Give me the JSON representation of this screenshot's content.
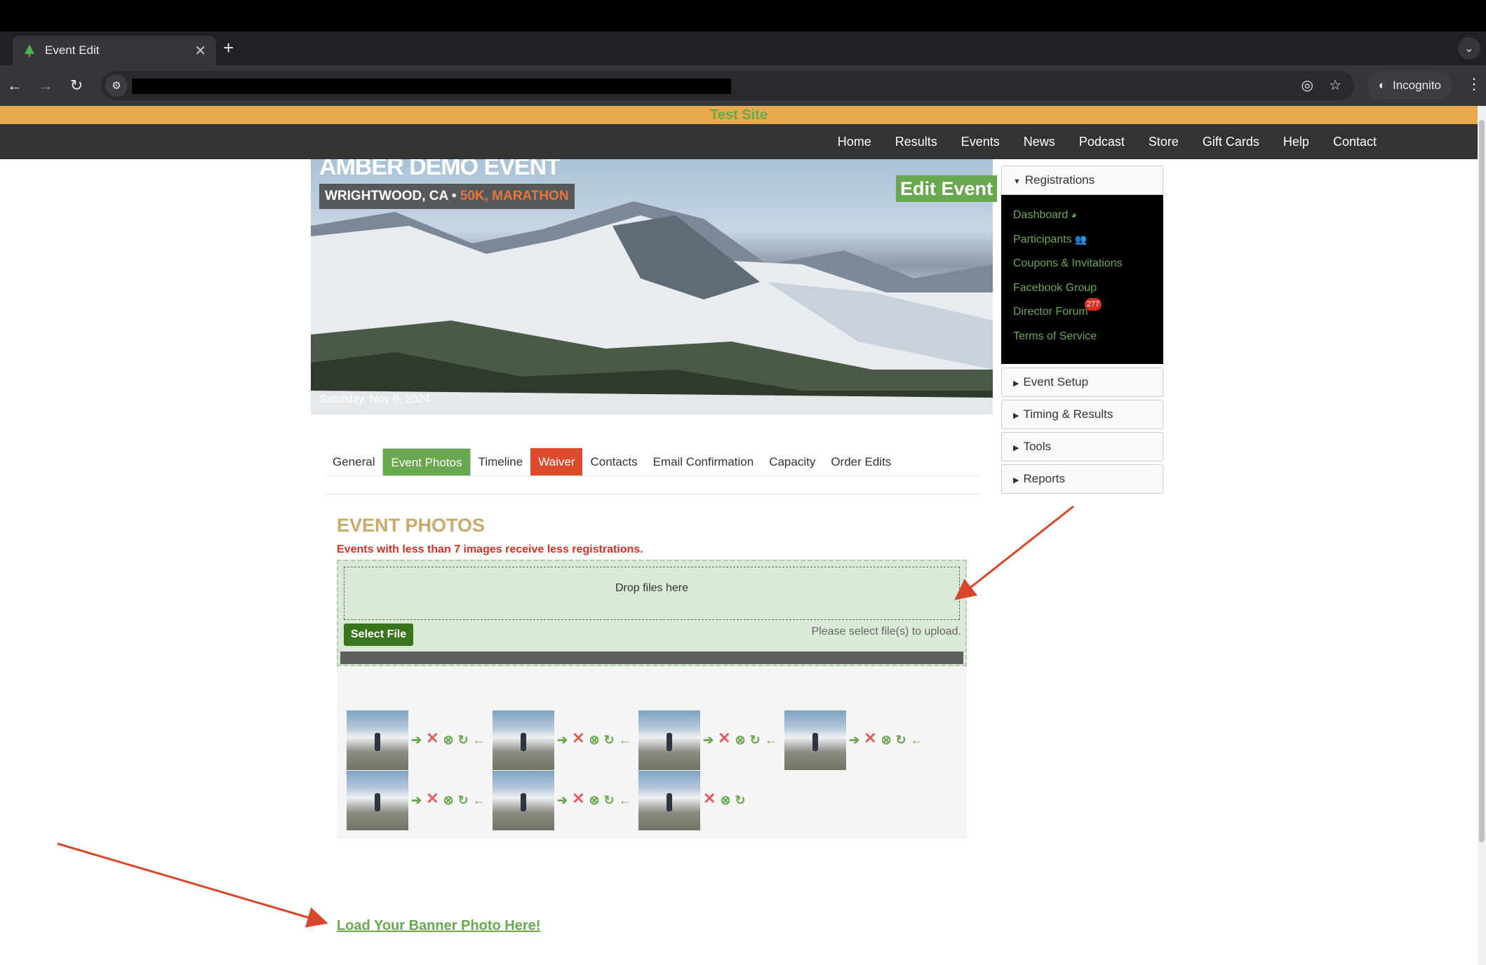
{
  "browser": {
    "tab_title": "Event Edit",
    "new_tab_symbol": "+",
    "incognito_label": "Incognito"
  },
  "site": {
    "banner": "Test Site",
    "nav": [
      "Home",
      "Results",
      "Events",
      "News",
      "Podcast",
      "Store",
      "Gift Cards",
      "Help",
      "Contact"
    ]
  },
  "event": {
    "title": "AMBER DEMO EVENT",
    "location": "WRIGHTWOOD, CA",
    "separator": "•",
    "distances": "50K, MARATHON",
    "date": "Saturday, Nov 9, 2024",
    "edit_label": "Edit Event"
  },
  "sidebar": {
    "registrations": "Registrations",
    "items": [
      "Dashboard",
      "Participants",
      "Coupons & Invitations",
      "Facebook Group",
      "Director Forum",
      "Terms of Service"
    ],
    "forum_badge": "277",
    "sections": [
      "Event Setup",
      "Timing & Results",
      "Tools",
      "Reports"
    ]
  },
  "tabs": [
    "General",
    "Event Photos",
    "Timeline",
    "Waiver",
    "Contacts",
    "Email Confirmation",
    "Capacity",
    "Order Edits"
  ],
  "photos": {
    "heading": "EVENT PHOTOS",
    "warning": "Events with less than 7 images receive less registrations.",
    "drop_text": "Drop files here",
    "select_label": "Select File",
    "status": "Please select file(s) to upload.",
    "count": 7
  },
  "banner_link": "Load Your Banner Photo Here!",
  "colors": {
    "accent_green": "#6aa84f",
    "test_banner": "#e8a94c",
    "waiver_red": "#dd4b2c",
    "heading_gold": "#c8a96e",
    "annotation_arrow": "#d9472b"
  }
}
